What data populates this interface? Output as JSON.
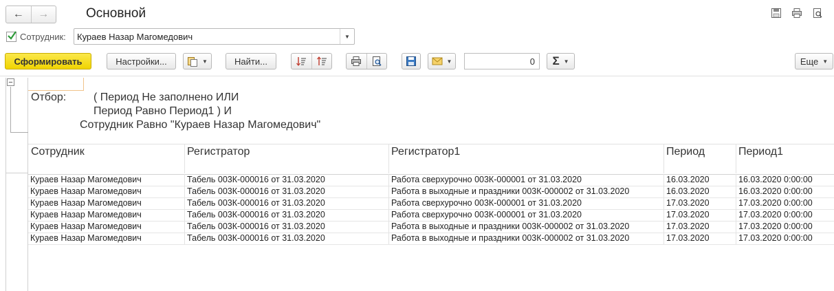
{
  "window": {
    "title": "Основной"
  },
  "nav": {
    "back": "←",
    "forward": "→"
  },
  "employee": {
    "label": "Сотрудник:",
    "value": "Кураев Назар Магомедович",
    "checked": true
  },
  "toolbar": {
    "generate": "Сформировать",
    "settings": "Настройки...",
    "find": "Найти...",
    "sum_value": "0",
    "sum_symbol": "Σ",
    "more": "Еще"
  },
  "report": {
    "filter_label": "Отбор:",
    "filter_line1": "( Период Не заполнено ИЛИ",
    "filter_line2": "Период Равно Период1 ) И",
    "filter_line3": "Сотрудник Равно \"Кураев Назар Магомедович\"",
    "columns": [
      "Сотрудник",
      "Регистратор",
      "Регистратор1",
      "Период",
      "Период1"
    ],
    "rows": [
      [
        "Кураев Назар Магомедович",
        "Табель 003К-000016 от 31.03.2020",
        "Работа сверхурочно 003К-000001 от 31.03.2020",
        "16.03.2020",
        "16.03.2020 0:00:00"
      ],
      [
        "Кураев Назар Магомедович",
        "Табель 003К-000016 от 31.03.2020",
        "Работа в выходные и праздники 003К-000002 от 31.03.2020",
        "16.03.2020",
        "16.03.2020 0:00:00"
      ],
      [
        "Кураев Назар Магомедович",
        "Табель 003К-000016 от 31.03.2020",
        "Работа сверхурочно 003К-000001 от 31.03.2020",
        "17.03.2020",
        "17.03.2020 0:00:00"
      ],
      [
        "Кураев Назар Магомедович",
        "Табель 003К-000016 от 31.03.2020",
        "Работа сверхурочно 003К-000001 от 31.03.2020",
        "17.03.2020",
        "17.03.2020 0:00:00"
      ],
      [
        "Кураев Назар Магомедович",
        "Табель 003К-000016 от 31.03.2020",
        "Работа в выходные и праздники 003К-000002 от 31.03.2020",
        "17.03.2020",
        "17.03.2020 0:00:00"
      ],
      [
        "Кураев Назар Магомедович",
        "Табель 003К-000016 от 31.03.2020",
        "Работа в выходные и праздники 003К-000002 от 31.03.2020",
        "17.03.2020",
        "17.03.2020 0:00:00"
      ]
    ]
  },
  "icons": [
    "save-icon",
    "print-icon",
    "preview-icon",
    "sort-asc-icon",
    "sort-desc-icon",
    "copy-icon",
    "mail-icon",
    "sum-icon",
    "collapse-icon",
    "checkbox-check-icon"
  ],
  "colors": {
    "primary_button": "#f5dc17",
    "check": "#2e9a3a"
  }
}
